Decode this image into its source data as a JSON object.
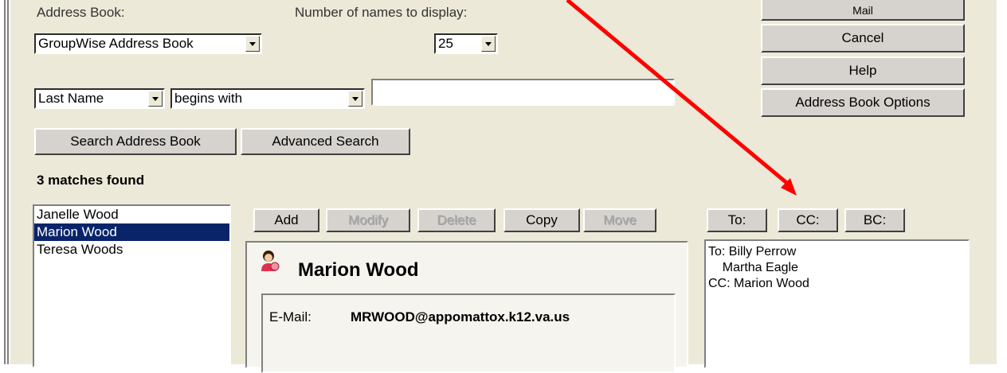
{
  "search": {
    "address_book_label": "Address Book:",
    "address_book_value": "GroupWise Address Book",
    "names_to_display_label": "Number of names to display:",
    "names_to_display_value": "25",
    "field_value": "Last Name",
    "condition_value": "begins with",
    "query_value": "",
    "search_button": "Search Address Book",
    "advanced_button": "Advanced Search",
    "matches_text": "3 matches found"
  },
  "actions": {
    "mail": "Mail",
    "cancel": "Cancel",
    "help": "Help",
    "options": "Address Book Options"
  },
  "results": [
    {
      "name": "Janelle Wood",
      "selected": false
    },
    {
      "name": "Marion Wood",
      "selected": true
    },
    {
      "name": "Teresa Woods",
      "selected": false
    }
  ],
  "toolbar": {
    "add": "Add",
    "modify": "Modify",
    "delete": "Delete",
    "copy": "Copy",
    "move": "Move"
  },
  "contact": {
    "name": "Marion Wood",
    "email_label": "E-Mail:",
    "email_value": "MRWOOD@appomattox.k12.va.us"
  },
  "recipients": {
    "to_button": "To:",
    "cc_button": "CC:",
    "bc_button": "BC:",
    "lines": [
      "To: Billy Perrow",
      "    Martha Eagle",
      "CC: Marion Wood"
    ]
  },
  "colors": {
    "window_bg": "#ECE9D8",
    "selection": "#0A246A",
    "annotation_arrow": "#FF0000"
  }
}
